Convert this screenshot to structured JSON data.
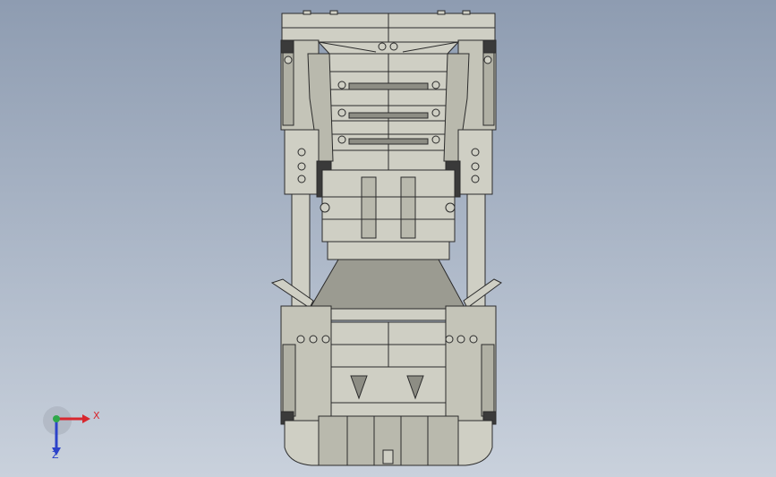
{
  "viewport": {
    "background_top": "#8e9cb1",
    "background_bottom": "#c9d1dc"
  },
  "model": {
    "fill": "#cfcfc4",
    "shade": "#b9b9ad",
    "dark": "#8d8d84",
    "edge": "#2b2b2b"
  },
  "triad": {
    "x_label": "X",
    "z_label": "Z",
    "x_color": "#d8272e",
    "y_color": "#2ea84a",
    "z_color": "#2c43c9"
  }
}
